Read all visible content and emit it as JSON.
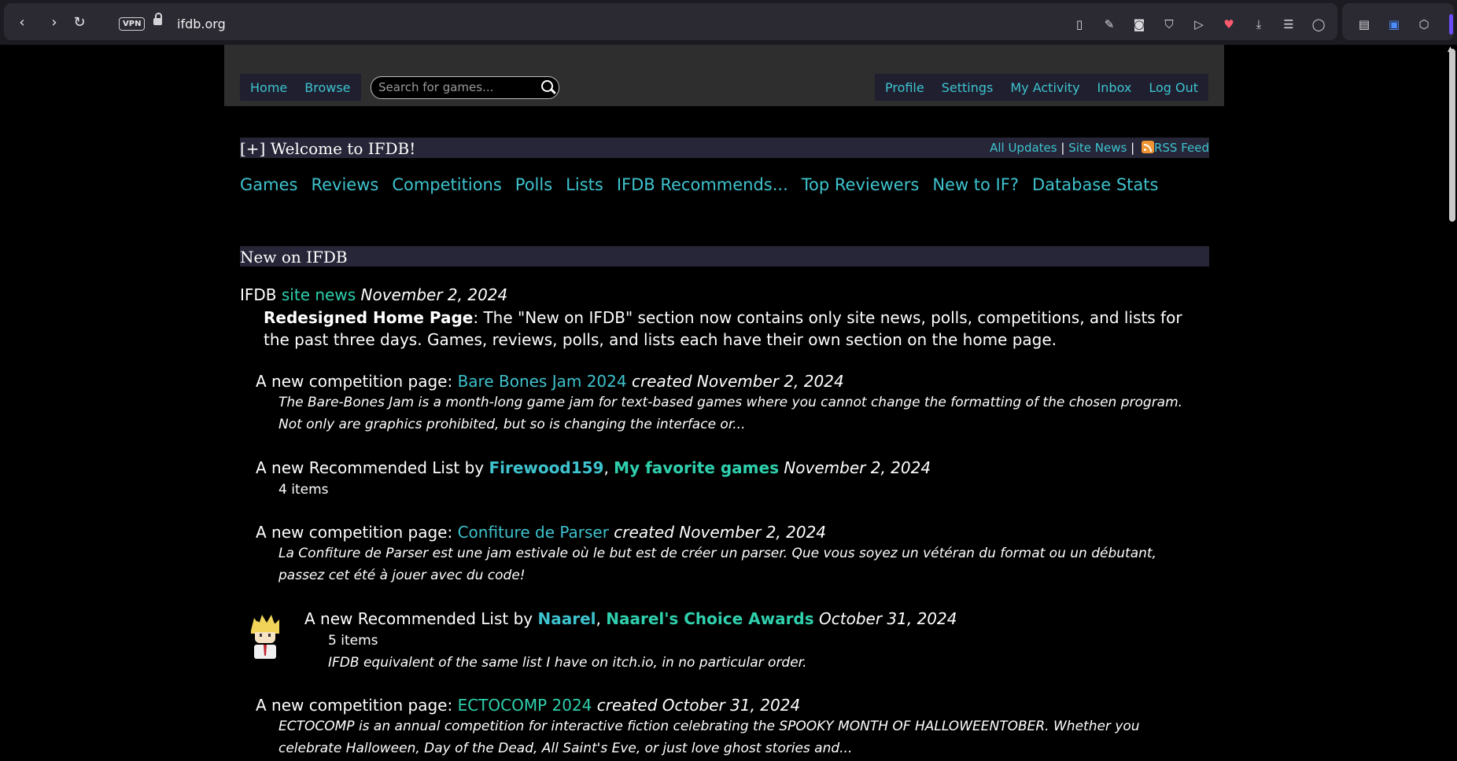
{
  "browser": {
    "vpn_label": "VPN",
    "url": "ifdb.org"
  },
  "header": {
    "nav_left": [
      "Home",
      "Browse"
    ],
    "search_placeholder": "Search for games...",
    "nav_right": [
      "Profile",
      "Settings",
      "My Activity",
      "Inbox",
      "Log Out"
    ]
  },
  "welcome": {
    "title": "[+] Welcome to IFDB!",
    "all_updates": "All Updates",
    "site_news": "Site News",
    "rss_feed": "RSS Feed",
    "separator": "|"
  },
  "main_nav": [
    "Games",
    "Reviews",
    "Competitions",
    "Polls",
    "Lists",
    "IFDB Recommends...",
    "Top Reviewers",
    "New to IF?",
    "Database Stats"
  ],
  "new_on_ifdb": {
    "title": "New on IFDB",
    "news": {
      "prefix": "IFDB",
      "link": "site news",
      "date": "November 2, 2024",
      "headline": "Redesigned Home Page",
      "body_1": ": The \"New on IFDB\" section now contains only site news, polls, competitions, and lists for",
      "body_2": "the past three days. Games, reviews, polls, and lists each have their own section on the home page."
    },
    "items": [
      {
        "prefix": "A new competition page: ",
        "link": "Bare Bones Jam 2024",
        "suffix": " created November 2, 2024",
        "desc_1": "The Bare-Bones Jam is a month-long game jam for text-based games where you cannot change the formatting of the chosen program.",
        "desc_2": "Not only are graphics prohibited, but so is changing the interface or..."
      },
      {
        "prefix": "A new Recommended List by ",
        "author": "Firewood159",
        "comma": ", ",
        "link": "My favorite games",
        "suffix": " November 2, 2024",
        "count": "4 items"
      },
      {
        "prefix": "A new competition page: ",
        "link": "Confiture de Parser",
        "suffix": " created November 2, 2024",
        "desc_1": "La Confiture de Parser est une jam estivale où le but est de créer un parser. Que vous soyez un vétéran du format ou un débutant,",
        "desc_2": "passez cet été à jouer avec du code!"
      },
      {
        "prefix": "A new Recommended List by ",
        "author": "Naarel",
        "comma": ", ",
        "link": "Naarel's Choice Awards",
        "suffix": " October 31, 2024",
        "count": "5 items",
        "desc_1": "IFDB equivalent of the same list I have on itch.io, in no particular order."
      },
      {
        "prefix": "A new competition page: ",
        "link": "ECTOCOMP 2024",
        "suffix": " created October 31, 2024",
        "desc_1": "ECTOCOMP is an annual competition for interactive fiction celebrating the SPOOKY MONTH OF HALLOWEENTOBER. Whether you",
        "desc_2": "celebrate Halloween, Day of the Dead, All Saint's Eve, or just love ghost stories and..."
      }
    ]
  }
}
